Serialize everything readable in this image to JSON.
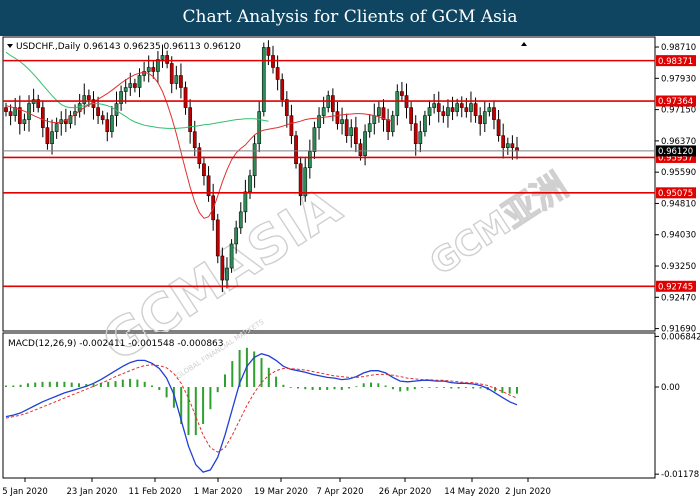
{
  "header": {
    "title": "Chart Analysis for Clients of GCM Asia"
  },
  "price_panel": {
    "symbol_line": "USDCHF.,Daily  0.96143 0.96235 0.96113 0.96120",
    "current_price_label": "0.96120",
    "ylim": [
      0.9163,
      0.9896
    ]
  },
  "macd_panel": {
    "label": "MACD(12,26,9) -0.002411 -0.001548 -0.000863",
    "ylim": [
      -0.0123,
      0.0073
    ]
  },
  "watermark": {
    "main": "GCMASIA",
    "sub": "GLOBAL FINANCIAL MARKETS",
    "side": "GCM亚洲"
  },
  "colors": {
    "level_line": "#e00000",
    "bull_candle": "#2e8b57",
    "bear_candle": "#c00000",
    "ma_fast": "#e03030",
    "ma_slow": "#30c070",
    "macd_line": "#1f3fd8",
    "signal_line": "#e03030",
    "histogram": "#2ea02e"
  },
  "chart_data": {
    "type": "candlestick",
    "symbol": "USDCHF.",
    "timeframe": "Daily",
    "y_ticks": [
      "0.98710",
      "0.97930",
      "0.97150",
      "0.96370",
      "0.95590",
      "0.94810",
      "0.94030",
      "0.93250",
      "0.92470",
      "0.91690"
    ],
    "horizontal_levels": [
      "0.98371",
      "0.97364",
      "0.95957",
      "0.95075",
      "0.92745"
    ],
    "current_price": "0.96120",
    "x_ticks": [
      "5 Jan 2020",
      "23 Jan 2020",
      "11 Feb 2020",
      "1 Mar 2020",
      "19 Mar 2020",
      "7 Apr 2020",
      "26 Apr 2020",
      "14 May 2020",
      "2 Jun 2020"
    ],
    "macd_ticks": [
      "0.006842",
      "0.00",
      "-0.011781"
    ],
    "close": [
      0.971,
      0.97,
      0.972,
      0.968,
      0.969,
      0.973,
      0.974,
      0.972,
      0.967,
      0.963,
      0.966,
      0.968,
      0.969,
      0.968,
      0.97,
      0.971,
      0.973,
      0.975,
      0.974,
      0.972,
      0.97,
      0.969,
      0.966,
      0.97,
      0.973,
      0.976,
      0.977,
      0.978,
      0.977,
      0.98,
      0.981,
      0.982,
      0.981,
      0.984,
      0.985,
      0.983,
      0.978,
      0.98,
      0.977,
      0.972,
      0.966,
      0.962,
      0.958,
      0.955,
      0.95,
      0.944,
      0.935,
      0.929,
      0.932,
      0.938,
      0.942,
      0.946,
      0.951,
      0.955,
      0.963,
      0.971,
      0.987,
      0.985,
      0.982,
      0.979,
      0.974,
      0.97,
      0.965,
      0.958,
      0.95,
      0.957,
      0.961,
      0.967,
      0.97,
      0.972,
      0.975,
      0.971,
      0.968,
      0.969,
      0.965,
      0.967,
      0.963,
      0.96,
      0.966,
      0.968,
      0.97,
      0.972,
      0.969,
      0.966,
      0.97,
      0.976,
      0.975,
      0.972,
      0.968,
      0.963,
      0.966,
      0.97,
      0.972,
      0.973,
      0.971,
      0.97,
      0.972,
      0.971,
      0.973,
      0.972,
      0.971,
      0.973,
      0.97,
      0.968,
      0.971,
      0.972,
      0.969,
      0.965,
      0.962,
      0.963,
      0.962,
      0.9612
    ],
    "ma_fast": [
      0.9725,
      0.9722,
      0.9719,
      0.9715,
      0.9711,
      0.9706,
      0.97,
      0.9695,
      0.969,
      0.9686,
      0.9683,
      0.9682,
      0.9684,
      0.9688,
      0.9695,
      0.9703,
      0.9712,
      0.972,
      0.9727,
      0.9734,
      0.9741,
      0.9748,
      0.9755,
      0.9763,
      0.9772,
      0.9781,
      0.9789,
      0.9796,
      0.9802,
      0.9806,
      0.9808,
      0.9805,
      0.9797,
      0.9782,
      0.976,
      0.973,
      0.9695,
      0.9655,
      0.961,
      0.9565,
      0.9522,
      0.9485,
      0.9458,
      0.9444,
      0.9448,
      0.9468,
      0.95,
      0.9535,
      0.9565,
      0.959,
      0.9607,
      0.9618,
      0.9627,
      0.964,
      0.9652,
      0.966,
      0.9664,
      0.9666,
      0.9668,
      0.967,
      0.9673,
      0.9677,
      0.9681,
      0.9683,
      0.9686,
      0.969,
      0.9692,
      0.9693,
      0.9694,
      0.9696,
      0.9697,
      0.9699,
      0.97,
      0.9702,
      0.9703,
      0.9704,
      0.9705,
      0.9705,
      0.9704,
      0.9702,
      0.97,
      0.9697,
      0.9693,
      0.9689,
      0.9685
    ],
    "ma_slow": [
      0.9858,
      0.985,
      0.9843,
      0.9835,
      0.9826,
      0.9815,
      0.9803,
      0.979,
      0.9776,
      0.9763,
      0.975,
      0.9738,
      0.9728,
      0.9722,
      0.972,
      0.972,
      0.9722,
      0.9725,
      0.9728,
      0.973,
      0.973,
      0.9728,
      0.9725,
      0.972,
      0.9713,
      0.9705,
      0.9698,
      0.969,
      0.9684,
      0.968,
      0.9676,
      0.9674,
      0.9672,
      0.967,
      0.9669,
      0.9668,
      0.9668,
      0.9668,
      0.9669,
      0.967,
      0.9672,
      0.9673,
      0.9675,
      0.9677,
      0.9678,
      0.968,
      0.9682,
      0.9684,
      0.9686,
      0.9688,
      0.969,
      0.9691,
      0.9692,
      0.9692,
      0.9692,
      0.969,
      0.9688,
      0.9686
    ],
    "macd": [
      -0.004,
      -0.0038,
      -0.0035,
      -0.003,
      -0.0025,
      -0.002,
      -0.0016,
      -0.0012,
      -0.0008,
      -0.0005,
      -0.0002,
      0.0001,
      0.0005,
      0.001,
      0.0016,
      0.0022,
      0.0028,
      0.0033,
      0.0036,
      0.0036,
      0.0032,
      0.0025,
      0.0012,
      -0.001,
      -0.0045,
      -0.008,
      -0.0105,
      -0.0115,
      -0.0112,
      -0.0095,
      -0.0065,
      -0.003,
      0.0005,
      0.0028,
      0.004,
      0.0045,
      0.0042,
      0.0036,
      0.0028,
      0.0024,
      0.0022,
      0.002,
      0.0017,
      0.0015,
      0.0013,
      0.0012,
      0.001,
      0.0011,
      0.0014,
      0.0019,
      0.0022,
      0.0022,
      0.0019,
      0.0013,
      0.0008,
      0.0007,
      0.0008,
      0.0009,
      0.0009,
      0.0008,
      0.0008,
      0.0006,
      0.0005,
      0.0005,
      0.0004,
      0.0002,
      -0.0002,
      -0.0008,
      -0.0014,
      -0.002,
      -0.0024
    ],
    "signal": [
      -0.0042,
      -0.004,
      -0.0038,
      -0.0035,
      -0.0031,
      -0.0027,
      -0.0023,
      -0.0019,
      -0.0015,
      -0.0011,
      -0.0007,
      -0.0003,
      0.0001,
      0.0005,
      0.0009,
      0.0014,
      0.0018,
      0.0022,
      0.0026,
      0.0029,
      0.003,
      0.0029,
      0.0026,
      0.0018,
      0.0005,
      -0.0015,
      -0.004,
      -0.0065,
      -0.0082,
      -0.0088,
      -0.0082,
      -0.0065,
      -0.0045,
      -0.0025,
      -0.0008,
      0.0006,
      0.0016,
      0.0022,
      0.0025,
      0.0025,
      0.0024,
      0.0023,
      0.0021,
      0.0019,
      0.0017,
      0.0015,
      0.0014,
      0.0013,
      0.0013,
      0.0014,
      0.0016,
      0.0017,
      0.0017,
      0.0016,
      0.0014,
      0.0012,
      0.0011,
      0.001,
      0.001,
      0.0009,
      0.0009,
      0.0008,
      0.0007,
      0.0006,
      0.0006,
      0.0004,
      0.0002,
      -0.0002,
      -0.0006,
      -0.0011,
      -0.0015
    ],
    "histogram": [
      0.0002,
      0.0002,
      0.0003,
      0.0005,
      0.0006,
      0.0007,
      0.0007,
      0.0007,
      0.0007,
      0.0006,
      0.0005,
      0.0004,
      0.0004,
      0.0005,
      0.0007,
      0.0008,
      0.001,
      0.0011,
      0.001,
      0.0007,
      0.0002,
      -0.0004,
      -0.0014,
      -0.0028,
      -0.005,
      -0.0065,
      -0.0065,
      -0.005,
      -0.003,
      -0.0007,
      0.0017,
      0.0035,
      0.005,
      0.0053,
      0.0048,
      0.0039,
      0.0026,
      0.0014,
      0.0003,
      -0.0001,
      -0.0002,
      -0.0003,
      -0.0004,
      -0.0004,
      -0.0004,
      -0.0003,
      -0.0004,
      -0.0002,
      0.0001,
      0.0005,
      0.0006,
      0.0005,
      0.0002,
      -0.0003,
      -0.0006,
      -0.0005,
      -0.0003,
      -0.0001,
      -0.0001,
      -0.0001,
      -0.0001,
      -0.0002,
      -0.0002,
      -0.0001,
      -0.0002,
      -0.0002,
      -0.0004,
      -0.0006,
      -0.0008,
      -0.0009,
      -0.0009
    ]
  }
}
